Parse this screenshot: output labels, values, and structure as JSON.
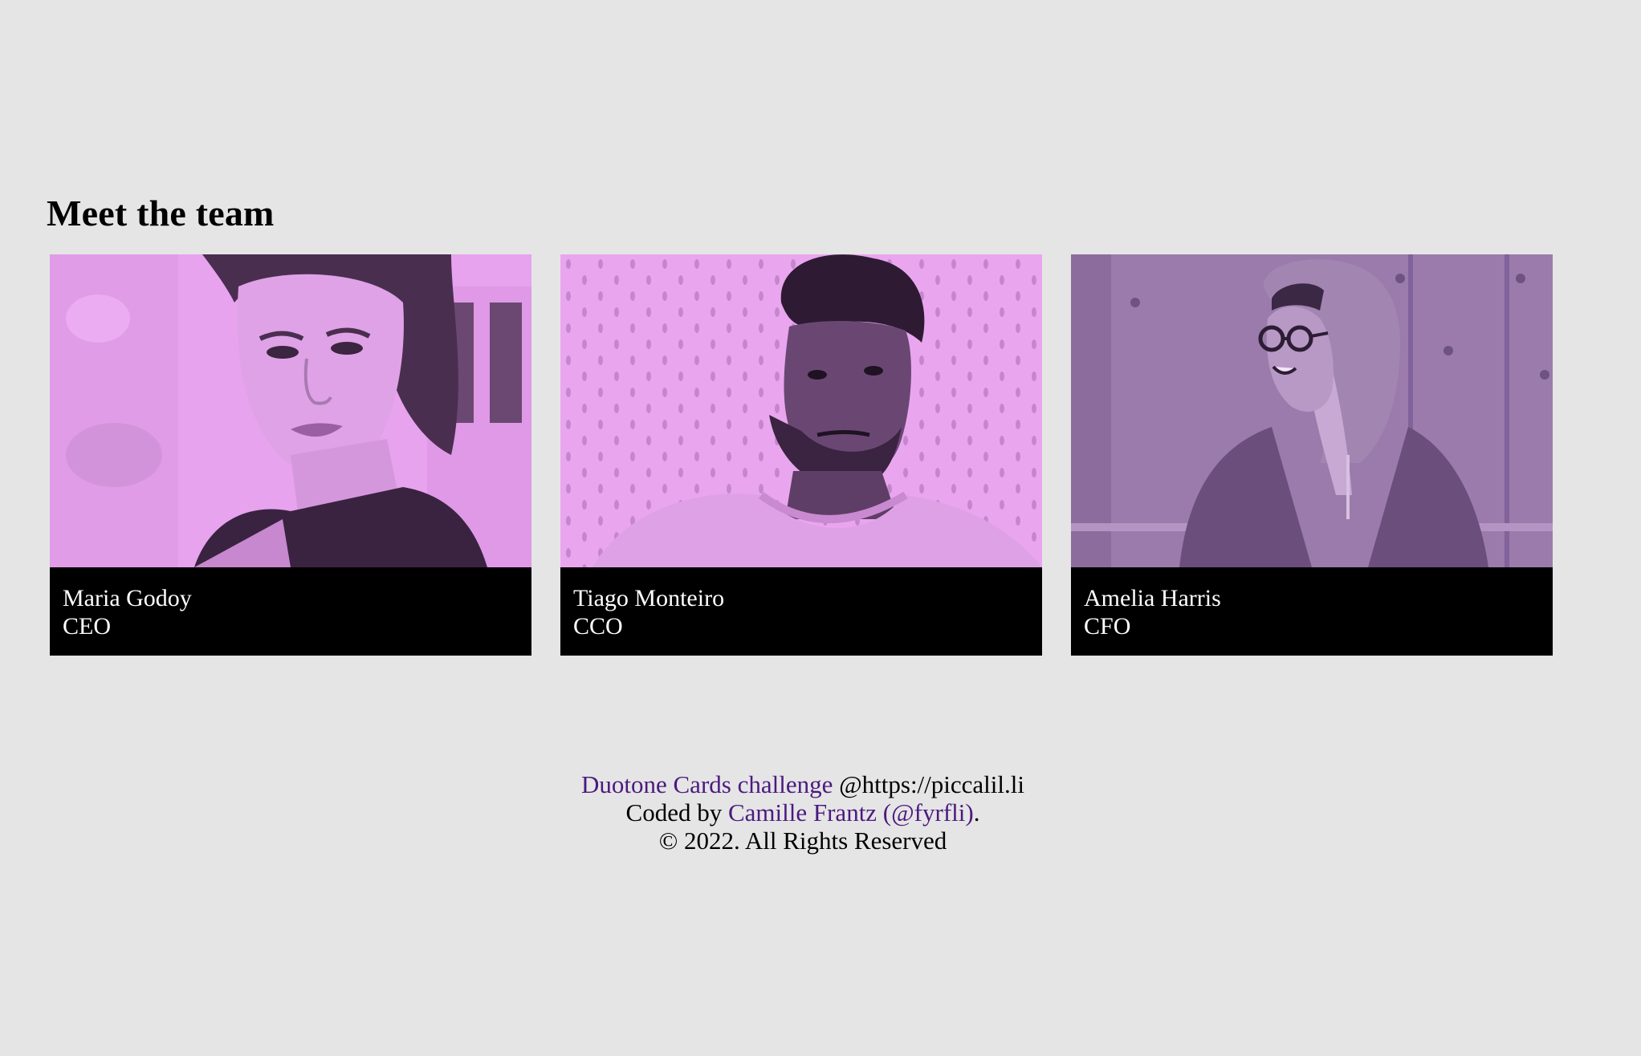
{
  "page": {
    "title": "Meet the team"
  },
  "team": [
    {
      "name": "Maria Godoy",
      "role": "CEO",
      "photo_icon": "woman-portrait-photo",
      "duotone": {
        "light": "#e7a3ee",
        "dark": "#6e4a7a"
      }
    },
    {
      "name": "Tiago Monteiro",
      "role": "CCO",
      "photo_icon": "man-portrait-photo",
      "duotone": {
        "light": "#e9a6ef",
        "dark": "#4a304f"
      }
    },
    {
      "name": "Amelia Harris",
      "role": "CFO",
      "photo_icon": "woman-hoodie-photo",
      "duotone": {
        "light": "#9b7bab",
        "dark": "#5b436a"
      }
    }
  ],
  "footer": {
    "challenge_link": "Duotone Cards challenge",
    "challenge_source": " @https://piccalil.li",
    "coded_by_prefix": "Coded by ",
    "author_link": "Camille Frantz (@fyrfli)",
    "coded_by_suffix": ".",
    "copyright": "© 2022. All Rights Reserved"
  },
  "colors": {
    "background": "#e5e5e5",
    "caption_bg": "#000000",
    "caption_text": "#ffffff",
    "link": "#4b1a80"
  }
}
